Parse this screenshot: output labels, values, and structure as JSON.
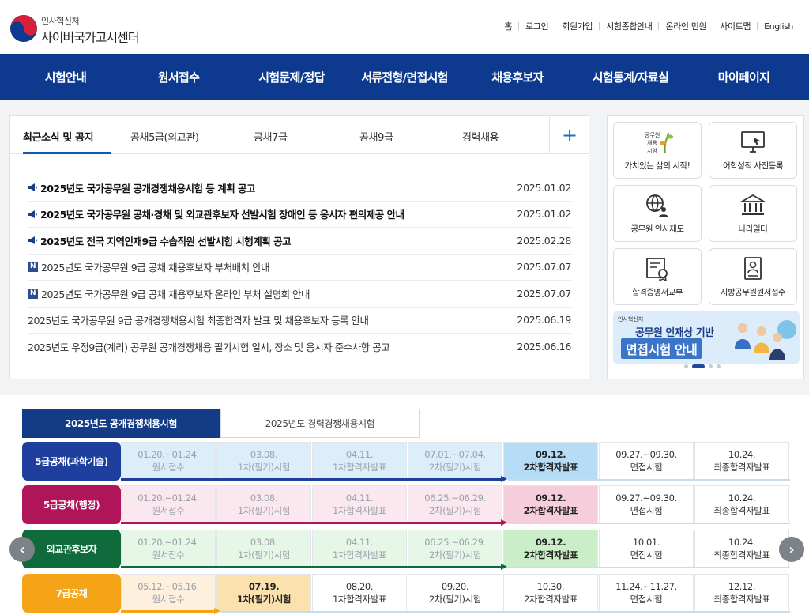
{
  "header": {
    "logo_sub": "인사혁신처",
    "logo_title": "사이버국가고시센터",
    "util_links": [
      "홈",
      "로그인",
      "회원가입",
      "시험종합안내",
      "온라인 민원",
      "사이트맵",
      "English"
    ]
  },
  "gnb": [
    "시험안내",
    "원서접수",
    "시험문제/정답",
    "서류전형/면접시험",
    "채용후보자",
    "시험통계/자료실",
    "마이페이지"
  ],
  "notice": {
    "tabs": [
      "최근소식 및 공지",
      "공채5급(외교관)",
      "공채7급",
      "공채9급",
      "경력채용"
    ],
    "plus": "+",
    "items": [
      {
        "title": "2025년도 국가공무원 공개경쟁채용시험 등 계획 공고",
        "date": "2025.01.02",
        "kind": "megaphone"
      },
      {
        "title": "2025년도 국가공무원 공채·경채 및 외교관후보자 선발시험 장애인 등 응시자 편의제공 안내",
        "date": "2025.01.02",
        "kind": "megaphone"
      },
      {
        "title": "2025년도 전국 지역인재9급 수습직원 선발시험 시행계획 공고",
        "date": "2025.02.28",
        "kind": "megaphone"
      },
      {
        "title": "2025년도 국가공무원 9급 공채 채용후보자 부처배치 안내",
        "date": "2025.07.07",
        "kind": "new"
      },
      {
        "title": "2025년도 국가공무원 9급 공채 채용후보자 온라인 부처 설명회 안내",
        "date": "2025.07.07",
        "kind": "new"
      },
      {
        "title": "2025년도 국가공무원 9급 공개경쟁채용시험 최종합격자 발표 및 채용후보자 등록 안내",
        "date": "2025.06.19",
        "kind": "plain"
      },
      {
        "title": "2025년도 우정9급(계리) 공무원 공개경쟁채용 필기시험 일시, 장소 및 응시자 준수사항 공고",
        "date": "2025.06.16",
        "kind": "plain"
      }
    ],
    "new_badge": "N"
  },
  "quick": {
    "items": [
      "가치있는 삶의 시작!",
      "어학성적 사전등록",
      "공무원 인사제도",
      "나라일터",
      "합격증명서교부",
      "지방공무원원서접수"
    ],
    "icon_text": "공무원\n채용\n시험",
    "banner": {
      "org": "인사혁신처",
      "line1": "공무원 인재상 기반",
      "line2": "면접시험 안내"
    }
  },
  "schedule": {
    "tabs": [
      "2025년도 공개경쟁채용시험",
      "2025년도 경력경쟁채용시험"
    ],
    "nav_prev": "‹",
    "nav_next": "›",
    "rows": [
      {
        "label": "5급공채(과학기술)",
        "color": "#1e3f9e",
        "tint": "#dceefa",
        "current_bg": "#b7dcf6",
        "current": 4,
        "cells": [
          [
            "01.20.~01.24.",
            "원서접수"
          ],
          [
            "03.08.",
            "1차(필기)시험"
          ],
          [
            "04.11.",
            "1차합격자발표"
          ],
          [
            "07.01.~07.04.",
            "2차(필기)시험"
          ],
          [
            "09.12.",
            "2차합격자발표"
          ],
          [
            "09.27.~09.30.",
            "면접시험"
          ],
          [
            "10.24.",
            "최종합격자발표"
          ]
        ]
      },
      {
        "label": "5급공채(행정)",
        "color": "#b0155a",
        "tint": "#fbe7ee",
        "current_bg": "#f6cdda",
        "current": 4,
        "cells": [
          [
            "01.20.~01.24.",
            "원서접수"
          ],
          [
            "03.08.",
            "1차(필기)시험"
          ],
          [
            "04.11.",
            "1차합격자발표"
          ],
          [
            "06.25.~06.29.",
            "2차(필기)시험"
          ],
          [
            "09.12.",
            "2차합격자발표"
          ],
          [
            "09.27.~09.30.",
            "면접시험"
          ],
          [
            "10.24.",
            "최종합격자발표"
          ]
        ]
      },
      {
        "label": "외교관후보자",
        "color": "#0f6a3c",
        "tint": "#e6f6e7",
        "current_bg": "#c9eec8",
        "current": 4,
        "cells": [
          [
            "01.20.~01.24.",
            "원서접수"
          ],
          [
            "03.08.",
            "1차(필기)시험"
          ],
          [
            "04.11.",
            "1차합격자발표"
          ],
          [
            "06.25.~06.29.",
            "2차(필기)시험"
          ],
          [
            "09.12.",
            "2차합격자발표"
          ],
          [
            "10.01.",
            "면접시험"
          ],
          [
            "10.24.",
            "최종합격자발표"
          ]
        ]
      },
      {
        "label": "7급공채",
        "color": "#f6a417",
        "tint": "#fdf1de",
        "current_bg": "#fbe1ad",
        "current": 1,
        "cells": [
          [
            "05.12.~05.16.",
            "원서접수"
          ],
          [
            "07.19.",
            "1차(필기)시험"
          ],
          [
            "08.20.",
            "1차합격자발표"
          ],
          [
            "09.20.",
            "2차(필기)시험"
          ],
          [
            "10.30.",
            "2차합격자발표"
          ],
          [
            "11.24.~11.27.",
            "면접시험"
          ],
          [
            "12.12.",
            "최종합격자발표"
          ]
        ]
      }
    ]
  }
}
